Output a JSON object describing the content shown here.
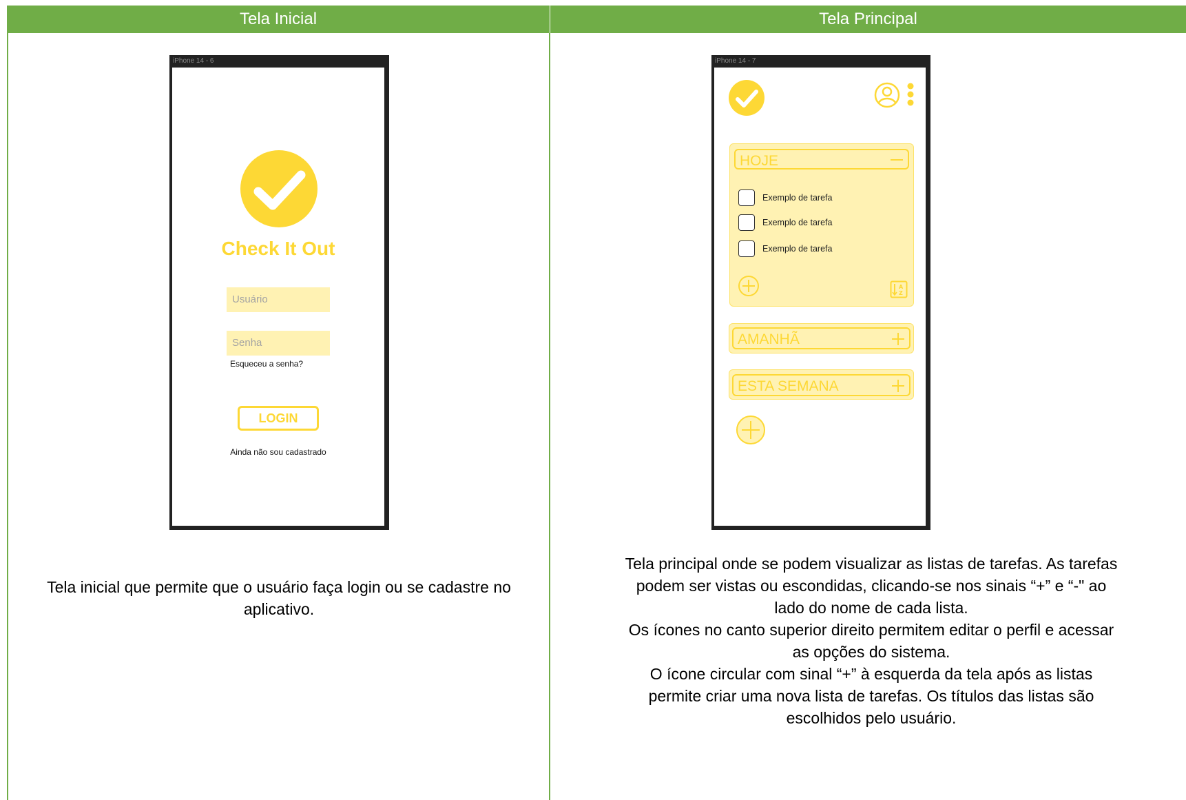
{
  "columns": {
    "left": {
      "header": "Tela Inicial",
      "phone": {
        "label": "iPhone 14 - 6",
        "app_name": "Check It Out",
        "username_placeholder": "Usuário",
        "password_placeholder": "Senha",
        "forgot_password": "Esqueceu a senha?",
        "login_button": "LOGIN",
        "register_link": "Ainda não sou cadastrado"
      },
      "caption": "Tela inicial que permite que o usuário faça login ou se cadastre no aplicativo."
    },
    "right": {
      "header": "Tela Principal",
      "phone": {
        "label": "iPhone 14 - 7",
        "lists": [
          {
            "title": "HOJE",
            "toggle": "minus",
            "tasks": [
              "Exemplo de tarefa",
              "Exemplo de tarefa",
              "Exemplo de tarefa"
            ]
          },
          {
            "title": "AMANHÃ",
            "toggle": "plus"
          },
          {
            "title": "ESTA SEMANA",
            "toggle": "plus"
          }
        ]
      },
      "caption_lines": [
        "Tela principal onde se podem visualizar as listas de tarefas. As tarefas",
        "podem ser vistas ou escondidas, clicando-se nos sinais “+” e “-\" ao",
        "lado do nome de cada lista.",
        "Os ícones no canto superior direito permitem editar o perfil e acessar",
        "as opções do sistema.",
        "O ícone circular com sinal “+” à esquerda da tela após as listas",
        "permite criar uma nova lista de tarefas. Os títulos das listas são",
        "escolhidos pelo usuário."
      ]
    }
  },
  "colors": {
    "table_green": "#70ad47",
    "accent_yellow": "#fdd835",
    "light_yellow": "#fff2b3"
  },
  "icons": [
    "check-circle-icon",
    "user-icon",
    "more-vertical-icon",
    "minus-icon",
    "plus-icon",
    "plus-circle-icon",
    "sort-az-icon"
  ]
}
